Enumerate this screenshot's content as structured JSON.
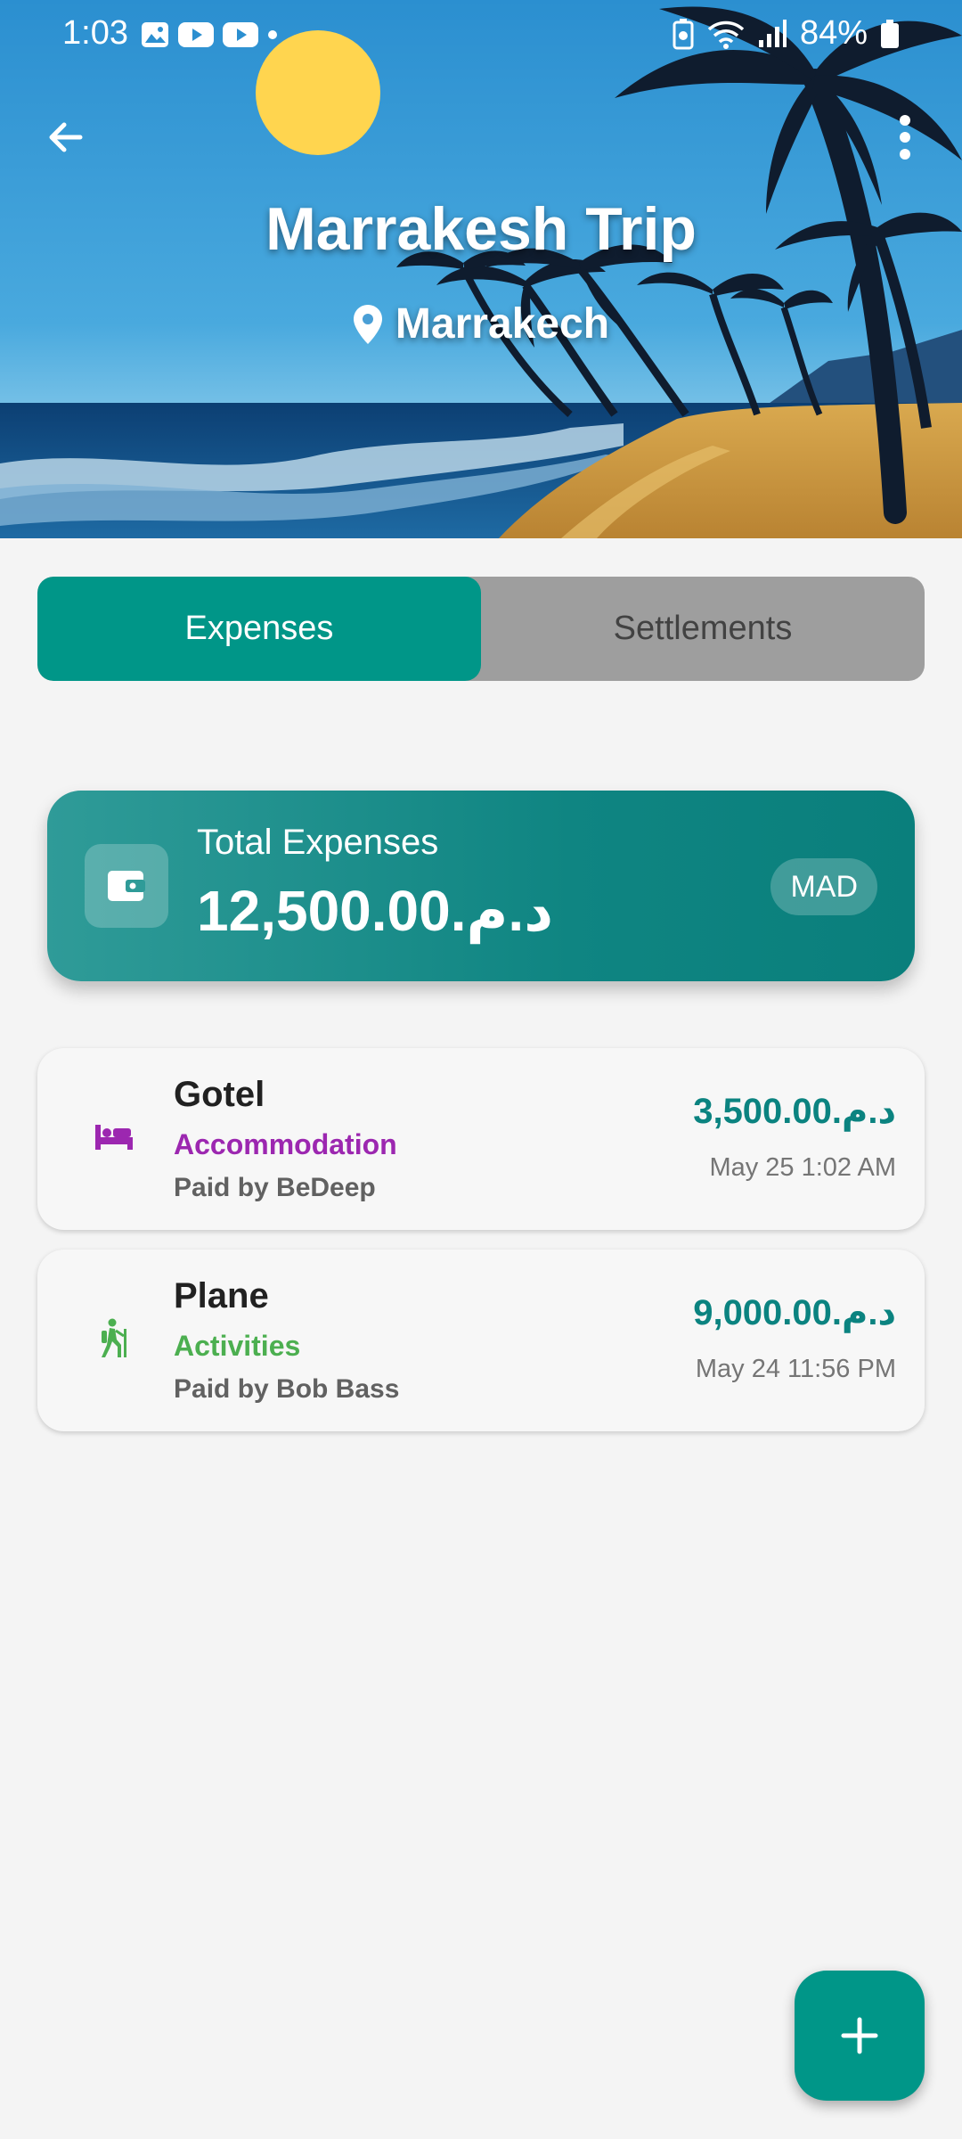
{
  "status_bar": {
    "time": "1:03",
    "battery": "84%",
    "icons_left": [
      "gallery-icon",
      "youtube-icon",
      "youtube-icon",
      "dot-icon"
    ],
    "icons_right": [
      "battery-saver-icon",
      "wifi-icon",
      "signal-icon",
      "battery-icon"
    ]
  },
  "header": {
    "title": "Marrakesh Trip",
    "location": "Marrakech",
    "back_icon": "arrow-left-icon",
    "menu_icon": "more-vert-icon"
  },
  "tabs": [
    {
      "label": "Expenses",
      "active": true
    },
    {
      "label": "Settlements",
      "active": false
    }
  ],
  "summary": {
    "label": "Total Expenses",
    "amount": "12,500.00.د.م",
    "currency": "MAD",
    "icon": "wallet-icon"
  },
  "expenses": [
    {
      "name": "Gotel",
      "category": "Accommodation",
      "category_color": "#9c27b0",
      "icon": "bed-icon",
      "paid_by": "Paid by BeDeep",
      "amount": "3,500.00.د.م",
      "date": "May 25 1:02 AM"
    },
    {
      "name": "Plane",
      "category": "Activities",
      "category_color": "#4caf50",
      "icon": "hiking-icon",
      "paid_by": "Paid by Bob Bass",
      "amount": "9,000.00.د.م",
      "date": "May 24 11:56 PM"
    }
  ],
  "fab": {
    "icon": "plus-icon"
  },
  "colors": {
    "primary": "#009688",
    "amount_text": "#0b8380",
    "tab_inactive_bg": "#9e9e9e",
    "background": "#f4f4f4"
  }
}
